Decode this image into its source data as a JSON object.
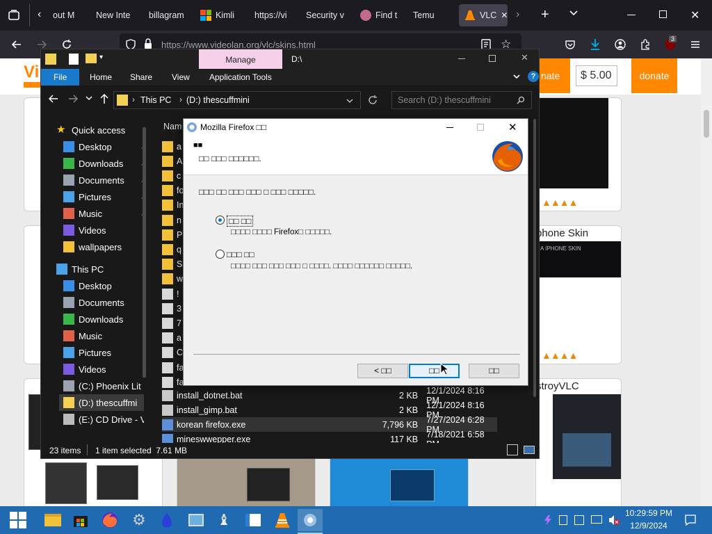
{
  "browser": {
    "tabs": [
      {
        "label": "out M",
        "icon": "generic-page-icon"
      },
      {
        "label": "New Inte",
        "icon": "generic-page-icon"
      },
      {
        "label": "billagram",
        "icon": "generic-page-icon"
      },
      {
        "label": "Kimli",
        "icon": "microsoft-icon"
      },
      {
        "label": "https://vi",
        "icon": "generic-page-icon"
      },
      {
        "label": "Security v",
        "icon": "generic-page-icon"
      },
      {
        "label": "Find t",
        "icon": "find-icon"
      },
      {
        "label": "Temu",
        "icon": "generic-page-icon"
      },
      {
        "label": "VLC",
        "icon": "vlc-icon"
      }
    ],
    "url": "https://www.videolan.org/vlc/skins.html",
    "extension_badge": "3"
  },
  "webpage": {
    "logo_fragment": "Vi",
    "donate_label": "nate",
    "donate_amount": "$ 5.00",
    "donate_button": "donate",
    "skin_titles": [
      "phone Skin",
      "stroyVLC"
    ],
    "skin_subtitle": "A IPHONE SKIN",
    "accent_color": "#ff8800"
  },
  "explorer": {
    "title_tab": "Manage",
    "title_path": "D:\\",
    "ribbon_tabs": [
      "File",
      "Home",
      "Share",
      "View",
      "Application Tools"
    ],
    "breadcrumb": [
      "This PC",
      "(D:) thescuffmini"
    ],
    "search_placeholder": "Search (D:) thescuffmini",
    "column_header": "Nam",
    "nav": {
      "quick_access": "Quick access",
      "quick_items": [
        "Desktop",
        "Downloads",
        "Documents",
        "Pictures",
        "Music",
        "Videos",
        "wallpapers"
      ],
      "this_pc": "This PC",
      "pc_items": [
        "Desktop",
        "Documents",
        "Downloads",
        "Music",
        "Pictures",
        "Videos",
        "(C:) Phoenix Lit",
        "(D:) thescuffmi",
        "(E:) CD Drive - V"
      ]
    },
    "partial_rows": [
      "a",
      "A",
      "c",
      "fo",
      "In",
      "n",
      "P",
      "q",
      "S",
      "w",
      "!",
      "3",
      "7",
      "a",
      "C",
      "fa",
      "fa"
    ],
    "files": [
      {
        "name": "install_dotnet.bat",
        "size": "2 KB",
        "date": "12/1/2024 8:16 PM"
      },
      {
        "name": "install_gimp.bat",
        "size": "2 KB",
        "date": "12/1/2024 8:16 PM"
      },
      {
        "name": "korean firefox.exe",
        "size": "7,796 KB",
        "date": "7/27/2024 6:28 PM"
      },
      {
        "name": "mineswwepper.exe",
        "size": "117 KB",
        "date": "7/18/2021 6:58 PM"
      }
    ],
    "status": {
      "items": "23 items",
      "selected": "1 item selected  7.61 MB"
    }
  },
  "dialog": {
    "title": "Mozilla Firefox □□",
    "header_title": "■■",
    "header_subtitle": "□□ □□□ □□□□□□.",
    "prompt": "□□□ □□ □□□ □□□ □ □□□ □□□□□.",
    "options": [
      {
        "label": "□□ □□",
        "desc": "□□□□ □□□□ Firefox□ □□□□□.",
        "selected": true
      },
      {
        "label": "□□□ □□",
        "desc": "□□□□ □□□ □□□ □□□ □ □□□□. □□□□ □□□□□□ □□□□□.",
        "selected": false
      }
    ],
    "buttons": {
      "back": "< □□",
      "next": "□□",
      "cancel": "□□"
    }
  },
  "taskbar": {
    "time": "10:29:59 PM",
    "date": "12/9/2024",
    "color": "#1f6ab0"
  }
}
